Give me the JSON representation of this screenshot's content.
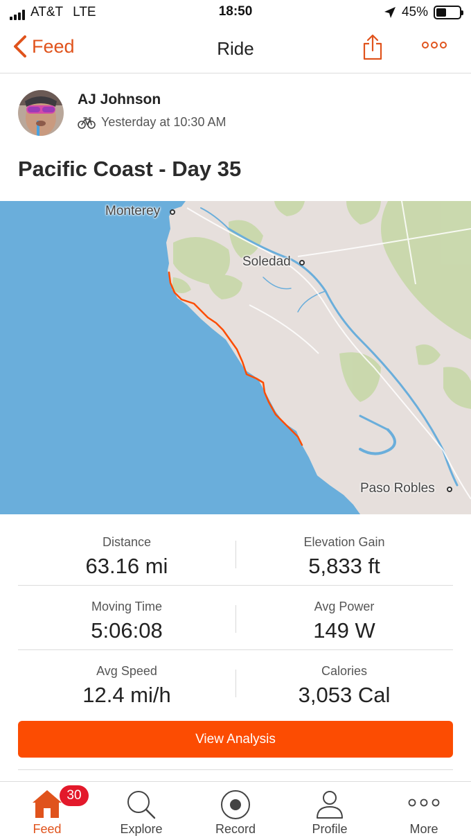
{
  "status_bar": {
    "carrier": "AT&T",
    "network": "LTE",
    "time": "18:50",
    "battery": "45%",
    "battery_fraction": 0.45
  },
  "nav": {
    "back_label": "Feed",
    "title": "Ride"
  },
  "activity": {
    "athlete": "AJ Johnson",
    "timestamp": "Yesterday at 10:30 AM",
    "title": "Pacific Coast - Day 35",
    "type_icon": "bicycle-icon"
  },
  "map": {
    "labels": {
      "monterey": "Monterey",
      "soledad": "Soledad",
      "paso_robles": "Paso Robles"
    },
    "route_color": "#fc4c02"
  },
  "stats": [
    {
      "left": {
        "label": "Distance",
        "value": "63.16 mi"
      },
      "right": {
        "label": "Elevation Gain",
        "value": "5,833 ft"
      }
    },
    {
      "left": {
        "label": "Moving Time",
        "value": "5:06:08"
      },
      "right": {
        "label": "Avg Power",
        "value": "149 W"
      }
    },
    {
      "left": {
        "label": "Avg Speed",
        "value": "12.4 mi/h"
      },
      "right": {
        "label": "Calories",
        "value": "3,053 Cal"
      }
    }
  ],
  "analysis_button": "View Analysis",
  "tab_bar": {
    "feed": {
      "label": "Feed",
      "badge": "30"
    },
    "explore": {
      "label": "Explore"
    },
    "record": {
      "label": "Record"
    },
    "profile": {
      "label": "Profile"
    },
    "more": {
      "label": "More"
    }
  },
  "colors": {
    "accent": "#fc4c02",
    "nav_accent": "#e0531c",
    "badge": "#e3192b",
    "water": "#6aaedb",
    "land": "#e7e1de"
  }
}
